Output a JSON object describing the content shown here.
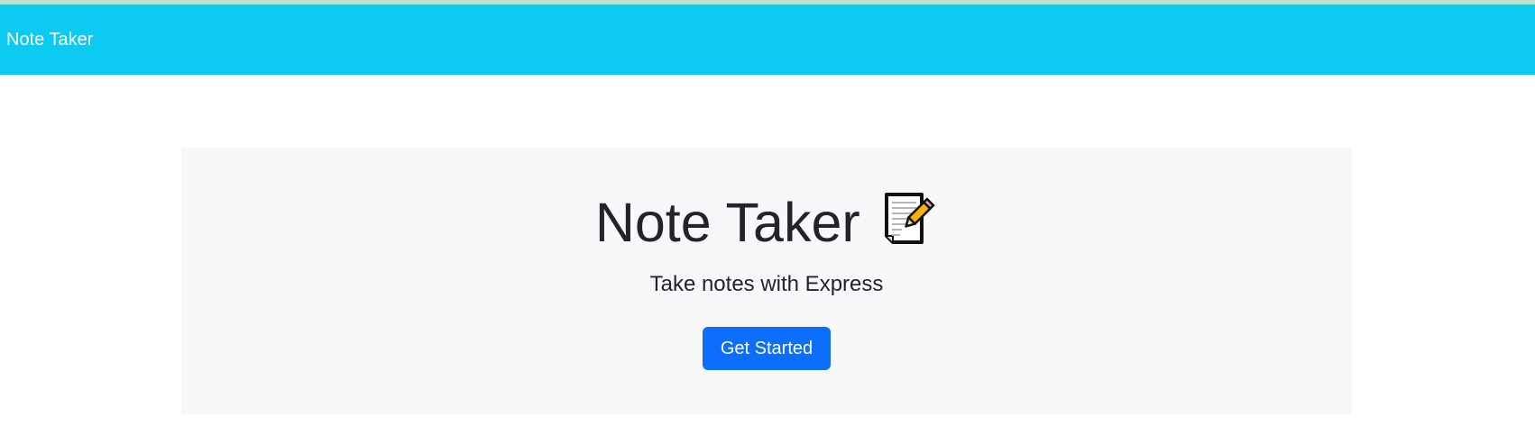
{
  "navbar": {
    "brand": "Note Taker"
  },
  "hero": {
    "title": "Note Taker",
    "title_icon": "memo-icon",
    "subtitle": "Take notes with Express",
    "cta_label": "Get Started"
  },
  "colors": {
    "navbar_bg": "#0dcaf0",
    "hero_bg": "#f7f8fa",
    "button_bg": "#0d6efd",
    "text": "#212529"
  }
}
